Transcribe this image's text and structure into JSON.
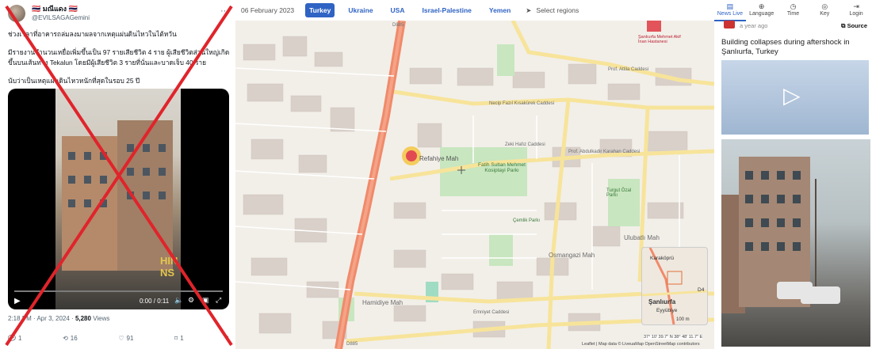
{
  "tweet": {
    "display_name": "🇹🇭 มณีแดง 🇹🇭",
    "handle": "@EVILSAGAGemini",
    "text_lines": [
      "ช่วงเวลาที่อาคารถล่มลงมาผลจากเหตุแผ่นดินไหวในไต้หวัน",
      "มีรายงานจำนวนเหยื่อเพิ่มขึ้นเป็น 97 รายเสียชีวิต 4 ราย ผู้เสียชีวิตส่วนใหญ่เกิดขึ้นบนเส้นทาง Tekalun โดยมีผู้เสียชีวิต 3 รายที่นั่นและบาดเจ็บ 40 ราย",
      "นับว่าเป็นเหตุแผ่นดินไหวหนักที่สุดในรอบ 25 ปี"
    ],
    "video": {
      "time": "0:00 / 0:11",
      "progress": 0,
      "watermark": "HIN NS"
    },
    "meta_time": "2:18 PM · Apr 3, 2024 · ",
    "views_count": "5,280",
    "views_label": " Views",
    "actions": {
      "replies": "1",
      "retweets": "16",
      "likes": "91",
      "bookmarks": "1"
    }
  },
  "map": {
    "date": "06 February 2023",
    "tabs": [
      {
        "label": "Turkey",
        "active": true
      },
      {
        "label": "Ukraine",
        "active": false
      },
      {
        "label": "USA",
        "active": false
      },
      {
        "label": "Israel-Palestine",
        "active": false
      },
      {
        "label": "Yemen",
        "active": false
      }
    ],
    "select_regions": "Select regions",
    "labels": {
      "refahiye": "Refahiye Mah",
      "fatih": "Fatih Sultan Mehmet Kosiptayi Parkı",
      "osmangazi": "Osmangazi Mah",
      "ulubatli": "Ulubatlı Mah",
      "hamidiye": "Hamidiye Mah",
      "turgut": "Turgut Özal Parkı",
      "d885_top": "D885",
      "d885_bottom": "D885",
      "necip": "Necip Fazıl Kısakürek Caddesi",
      "prof_attila": "Prof. Attila Caddesi",
      "abdulkadir": "Prof. Abdulkadir Karahan Caddesi",
      "zeki": "Zeki Hafız Caddesi",
      "emniyet": "Emniyet Caddesi",
      "cemlik": "Çemlik Parkı",
      "hospital": "Şanlıurfa Mehmet Akif İnan Hastanesi"
    },
    "inset": {
      "karakopru": "Karaköprü",
      "sanliurfa": "Şanlıurfa",
      "eyyubiye": "Eyyübiye",
      "road": "D4"
    },
    "scale": "100 m",
    "coords": "37° 10' 39.7\" N 38° 48' 11.7\" E",
    "attribution": "Leaflet | Map data © LiveuaMap OpenStreetMap contributors"
  },
  "news": {
    "nav": [
      {
        "label": "News Live",
        "icon": "news-icon",
        "active": true
      },
      {
        "label": "Language",
        "icon": "language-icon",
        "active": false
      },
      {
        "label": "Time",
        "icon": "clock-icon",
        "active": false
      },
      {
        "label": "Key",
        "icon": "key-icon",
        "active": false
      },
      {
        "label": "Login",
        "icon": "login-icon",
        "active": false
      }
    ],
    "ago": "a year ago",
    "source": "Source",
    "title": "Building collapses during aftershock in Şanlıurfa, Turkey"
  },
  "colors": {
    "accent": "#2f63c4",
    "main_road": "#f08a6b",
    "cross": "#e0242b",
    "park": "#c8e6bf"
  }
}
